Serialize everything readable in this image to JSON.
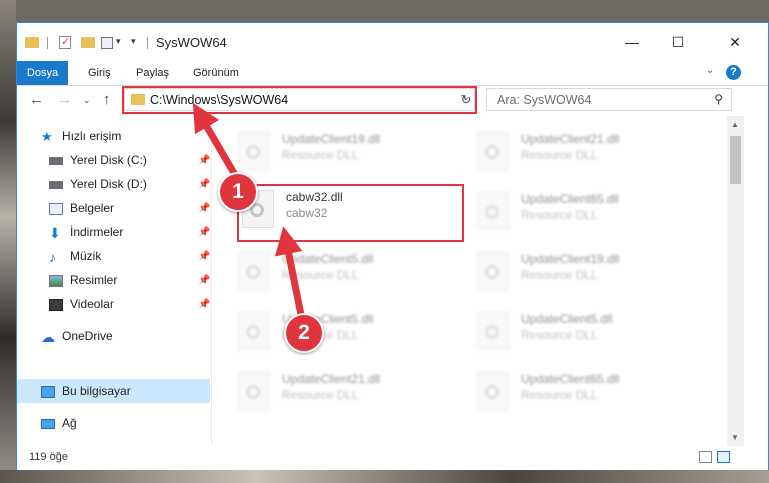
{
  "window": {
    "title": "SysWOW64"
  },
  "ribbon": {
    "tabs": [
      "Dosya",
      "Giriş",
      "Paylaş",
      "Görünüm"
    ],
    "help": "?"
  },
  "address": {
    "path": "C:\\Windows\\SysWOW64"
  },
  "search": {
    "placeholder": "Ara: SysWOW64"
  },
  "sidebar": {
    "quick_access": "Hızlı erişim",
    "items": [
      "Yerel Disk (C:)",
      "Yerel Disk (D:)",
      "Belgeler",
      "İndirmeler",
      "Müzik",
      "Resimler",
      "Videolar"
    ],
    "onedrive": "OneDrive",
    "this_pc": "Bu bilgisayar",
    "network": "Ağ"
  },
  "files": {
    "left": [
      {
        "name": "UpdateClient19.dll",
        "desc": "Resource DLL"
      },
      {
        "name": "cabw32.dll",
        "desc": "cabw32"
      },
      {
        "name": "UpdateClient5.dll",
        "desc": "Resource DLL"
      },
      {
        "name": "UpdateClient5.dll",
        "desc": "Resource DLL"
      },
      {
        "name": "UpdateClient21.dll",
        "desc": "Resource DLL"
      }
    ],
    "right": [
      {
        "name": "UpdateClient21.dll",
        "desc": "Resource DLL"
      },
      {
        "name": "UpdateClient65.dll",
        "desc": "Resource DLL"
      },
      {
        "name": "UpdateClient19.dll",
        "desc": "Resource DLL"
      },
      {
        "name": "UpdateClient5.dll",
        "desc": "Resource DLL"
      },
      {
        "name": "UpdateClient65.dll",
        "desc": "Resource DLL"
      }
    ]
  },
  "status": {
    "count": "119 öğe"
  },
  "callouts": {
    "one": "1",
    "two": "2"
  },
  "colors": {
    "accent": "#1979ca",
    "highlight": "#e0353c",
    "selected": "#cce8ff"
  }
}
